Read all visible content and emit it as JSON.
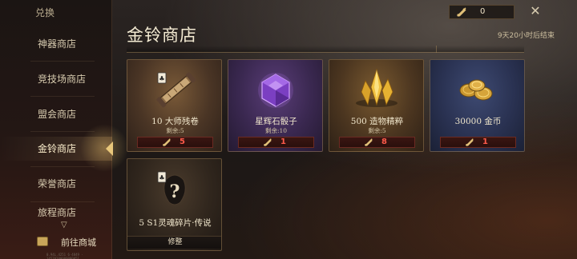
{
  "sidebar": {
    "title": "兑换",
    "items": [
      {
        "label": "神器商店",
        "active": false
      },
      {
        "label": "竞技场商店",
        "active": false
      },
      {
        "label": "盟会商店",
        "active": false
      },
      {
        "label": "金铃商店",
        "active": true
      },
      {
        "label": "荣誉商店",
        "active": false
      },
      {
        "label": "旅程商店",
        "active": false
      }
    ],
    "mall_link": "前往商城",
    "footer_id": "0.94L.4251 6·4849 · 14570200000000051"
  },
  "header": {
    "title": "金铃商店",
    "currency_icon": "golden-bell-icon",
    "currency_value": "0",
    "timer": "9天20小时后结束",
    "close_icon": "close-icon"
  },
  "colors": {
    "accent_gold": "#e8c77b",
    "price_red": "#ff5a4a",
    "price_bar_bg": "#2a0f0c"
  },
  "items": [
    {
      "name": "10 大师残卷",
      "remain": "剩余:5",
      "price": "5",
      "bg": "brown",
      "icon": "scroll-icon"
    },
    {
      "name": "星辉石骰子",
      "remain": "剩余:10",
      "price": "1",
      "bg": "purple",
      "icon": "purple-gem-icon"
    },
    {
      "name": "500 造物精粹",
      "remain": "剩余:5",
      "price": "8",
      "bg": "gold",
      "icon": "gold-crystal-icon"
    },
    {
      "name": "30000 金币",
      "remain": "",
      "price": "1",
      "bg": "blue",
      "icon": "gold-coins-icon"
    },
    {
      "name": "5 S1灵魂碎片·传说",
      "remain": "",
      "price": "",
      "bg": "dark",
      "icon": "soul-shard-icon",
      "button": "修整"
    }
  ]
}
